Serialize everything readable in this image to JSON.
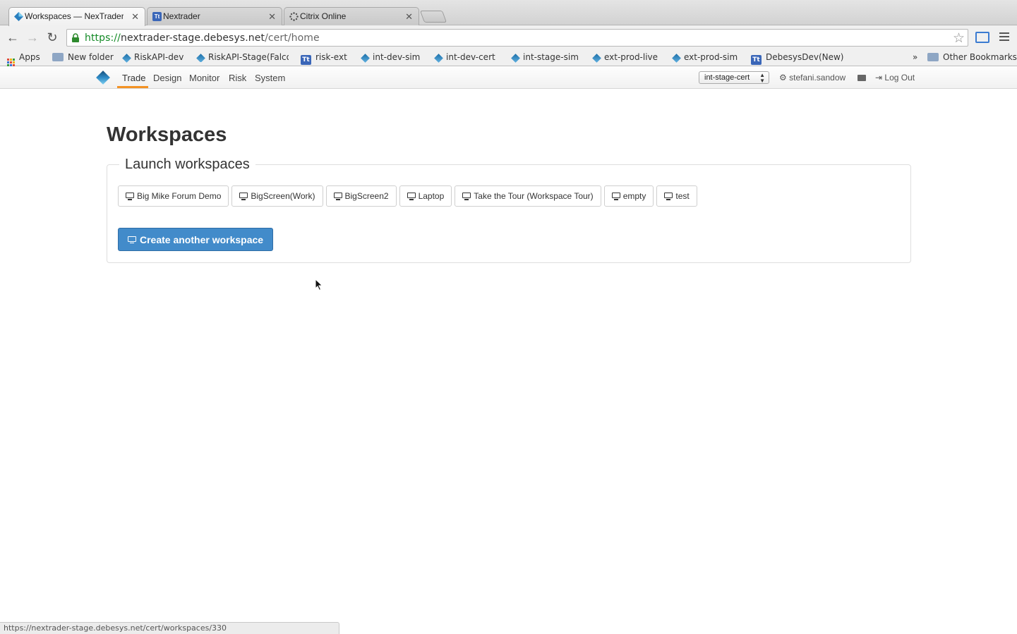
{
  "browser": {
    "tabs": [
      {
        "title": "Workspaces — NexTrader",
        "active": true,
        "icon": "diamond-icon"
      },
      {
        "title": "Nextrader",
        "active": false,
        "icon": "tt-icon"
      },
      {
        "title": "Citrix Online",
        "active": false,
        "icon": "citrix-icon"
      }
    ],
    "url_scheme": "https://",
    "url_host": "nextrader-stage.debesys.net",
    "url_path": "/cert/home",
    "bookmarks": [
      {
        "label": "Apps",
        "icon": "apps-grid-icon"
      },
      {
        "label": "New folder",
        "icon": "folder-icon"
      },
      {
        "label": "RiskAPI-dev",
        "icon": "diamond-icon"
      },
      {
        "label": "RiskAPI-Stage(Falco",
        "icon": "diamond-icon"
      },
      {
        "label": "risk-ext",
        "icon": "tt-icon"
      },
      {
        "label": "int-dev-sim",
        "icon": "diamond-icon"
      },
      {
        "label": "int-dev-cert",
        "icon": "diamond-icon"
      },
      {
        "label": "int-stage-sim",
        "icon": "diamond-icon"
      },
      {
        "label": "ext-prod-live",
        "icon": "diamond-icon"
      },
      {
        "label": "ext-prod-sim",
        "icon": "diamond-icon"
      },
      {
        "label": "DebesysDev(New)",
        "icon": "tt-icon"
      }
    ],
    "overflow_label": "»",
    "other_bookmarks": "Other Bookmarks",
    "status_url": "https://nextrader-stage.debesys.net/cert/workspaces/330"
  },
  "appnav": {
    "items": [
      "Trade",
      "Design",
      "Monitor",
      "Risk",
      "System"
    ],
    "active": "Trade",
    "environment": "int-stage-cert",
    "username": "stefani.sandow",
    "logout": "Log Out"
  },
  "main": {
    "title": "Workspaces",
    "legend": "Launch workspaces",
    "workspaces": [
      "Big Mike Forum Demo",
      "BigScreen(Work)",
      "BigScreen2",
      "Laptop",
      "Take the Tour (Workspace Tour)",
      "empty",
      "test"
    ],
    "create_label": "Create another workspace"
  },
  "colors": {
    "accent": "#f39224",
    "primary_button": "#428bca",
    "url_scheme": "#138a26"
  }
}
